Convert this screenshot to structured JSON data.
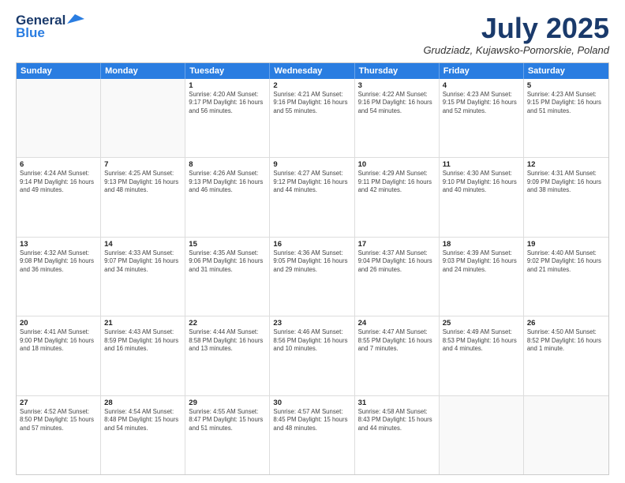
{
  "header": {
    "logo_line1": "General",
    "logo_line2": "Blue",
    "month_title": "July 2025",
    "subtitle": "Grudziadz, Kujawsko-Pomorskie, Poland"
  },
  "weekdays": [
    "Sunday",
    "Monday",
    "Tuesday",
    "Wednesday",
    "Thursday",
    "Friday",
    "Saturday"
  ],
  "rows": [
    [
      {
        "day": "",
        "text": ""
      },
      {
        "day": "",
        "text": ""
      },
      {
        "day": "1",
        "text": "Sunrise: 4:20 AM\nSunset: 9:17 PM\nDaylight: 16 hours\nand 56 minutes."
      },
      {
        "day": "2",
        "text": "Sunrise: 4:21 AM\nSunset: 9:16 PM\nDaylight: 16 hours\nand 55 minutes."
      },
      {
        "day": "3",
        "text": "Sunrise: 4:22 AM\nSunset: 9:16 PM\nDaylight: 16 hours\nand 54 minutes."
      },
      {
        "day": "4",
        "text": "Sunrise: 4:23 AM\nSunset: 9:15 PM\nDaylight: 16 hours\nand 52 minutes."
      },
      {
        "day": "5",
        "text": "Sunrise: 4:23 AM\nSunset: 9:15 PM\nDaylight: 16 hours\nand 51 minutes."
      }
    ],
    [
      {
        "day": "6",
        "text": "Sunrise: 4:24 AM\nSunset: 9:14 PM\nDaylight: 16 hours\nand 49 minutes."
      },
      {
        "day": "7",
        "text": "Sunrise: 4:25 AM\nSunset: 9:13 PM\nDaylight: 16 hours\nand 48 minutes."
      },
      {
        "day": "8",
        "text": "Sunrise: 4:26 AM\nSunset: 9:13 PM\nDaylight: 16 hours\nand 46 minutes."
      },
      {
        "day": "9",
        "text": "Sunrise: 4:27 AM\nSunset: 9:12 PM\nDaylight: 16 hours\nand 44 minutes."
      },
      {
        "day": "10",
        "text": "Sunrise: 4:29 AM\nSunset: 9:11 PM\nDaylight: 16 hours\nand 42 minutes."
      },
      {
        "day": "11",
        "text": "Sunrise: 4:30 AM\nSunset: 9:10 PM\nDaylight: 16 hours\nand 40 minutes."
      },
      {
        "day": "12",
        "text": "Sunrise: 4:31 AM\nSunset: 9:09 PM\nDaylight: 16 hours\nand 38 minutes."
      }
    ],
    [
      {
        "day": "13",
        "text": "Sunrise: 4:32 AM\nSunset: 9:08 PM\nDaylight: 16 hours\nand 36 minutes."
      },
      {
        "day": "14",
        "text": "Sunrise: 4:33 AM\nSunset: 9:07 PM\nDaylight: 16 hours\nand 34 minutes."
      },
      {
        "day": "15",
        "text": "Sunrise: 4:35 AM\nSunset: 9:06 PM\nDaylight: 16 hours\nand 31 minutes."
      },
      {
        "day": "16",
        "text": "Sunrise: 4:36 AM\nSunset: 9:05 PM\nDaylight: 16 hours\nand 29 minutes."
      },
      {
        "day": "17",
        "text": "Sunrise: 4:37 AM\nSunset: 9:04 PM\nDaylight: 16 hours\nand 26 minutes."
      },
      {
        "day": "18",
        "text": "Sunrise: 4:39 AM\nSunset: 9:03 PM\nDaylight: 16 hours\nand 24 minutes."
      },
      {
        "day": "19",
        "text": "Sunrise: 4:40 AM\nSunset: 9:02 PM\nDaylight: 16 hours\nand 21 minutes."
      }
    ],
    [
      {
        "day": "20",
        "text": "Sunrise: 4:41 AM\nSunset: 9:00 PM\nDaylight: 16 hours\nand 18 minutes."
      },
      {
        "day": "21",
        "text": "Sunrise: 4:43 AM\nSunset: 8:59 PM\nDaylight: 16 hours\nand 16 minutes."
      },
      {
        "day": "22",
        "text": "Sunrise: 4:44 AM\nSunset: 8:58 PM\nDaylight: 16 hours\nand 13 minutes."
      },
      {
        "day": "23",
        "text": "Sunrise: 4:46 AM\nSunset: 8:56 PM\nDaylight: 16 hours\nand 10 minutes."
      },
      {
        "day": "24",
        "text": "Sunrise: 4:47 AM\nSunset: 8:55 PM\nDaylight: 16 hours\nand 7 minutes."
      },
      {
        "day": "25",
        "text": "Sunrise: 4:49 AM\nSunset: 8:53 PM\nDaylight: 16 hours\nand 4 minutes."
      },
      {
        "day": "26",
        "text": "Sunrise: 4:50 AM\nSunset: 8:52 PM\nDaylight: 16 hours\nand 1 minute."
      }
    ],
    [
      {
        "day": "27",
        "text": "Sunrise: 4:52 AM\nSunset: 8:50 PM\nDaylight: 15 hours\nand 57 minutes."
      },
      {
        "day": "28",
        "text": "Sunrise: 4:54 AM\nSunset: 8:48 PM\nDaylight: 15 hours\nand 54 minutes."
      },
      {
        "day": "29",
        "text": "Sunrise: 4:55 AM\nSunset: 8:47 PM\nDaylight: 15 hours\nand 51 minutes."
      },
      {
        "day": "30",
        "text": "Sunrise: 4:57 AM\nSunset: 8:45 PM\nDaylight: 15 hours\nand 48 minutes."
      },
      {
        "day": "31",
        "text": "Sunrise: 4:58 AM\nSunset: 8:43 PM\nDaylight: 15 hours\nand 44 minutes."
      },
      {
        "day": "",
        "text": ""
      },
      {
        "day": "",
        "text": ""
      }
    ]
  ]
}
